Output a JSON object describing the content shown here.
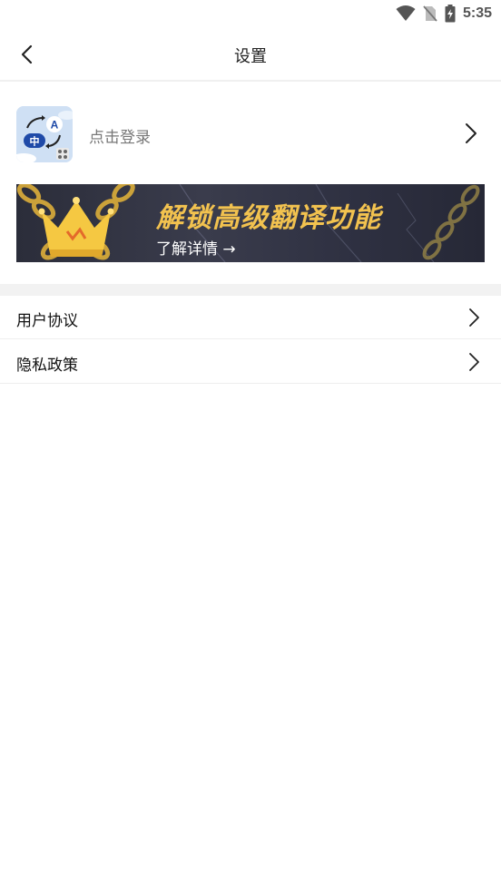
{
  "status_bar": {
    "time": "5:35",
    "icons": [
      "wifi-icon",
      "no-sim-icon",
      "battery-charging-icon"
    ]
  },
  "header": {
    "title": "设置",
    "back_icon": "chevron-left-icon"
  },
  "profile": {
    "login_text": "点击登录",
    "avatar_labels": {
      "a": "A",
      "zh": "中"
    }
  },
  "banner": {
    "title": "解锁高级翻译功能",
    "subtitle": "了解详情 →",
    "colors": {
      "title": "#f2c24f",
      "crown": "#f5c842"
    }
  },
  "menu": {
    "items": [
      {
        "label": "用户协议"
      },
      {
        "label": "隐私政策"
      }
    ]
  }
}
